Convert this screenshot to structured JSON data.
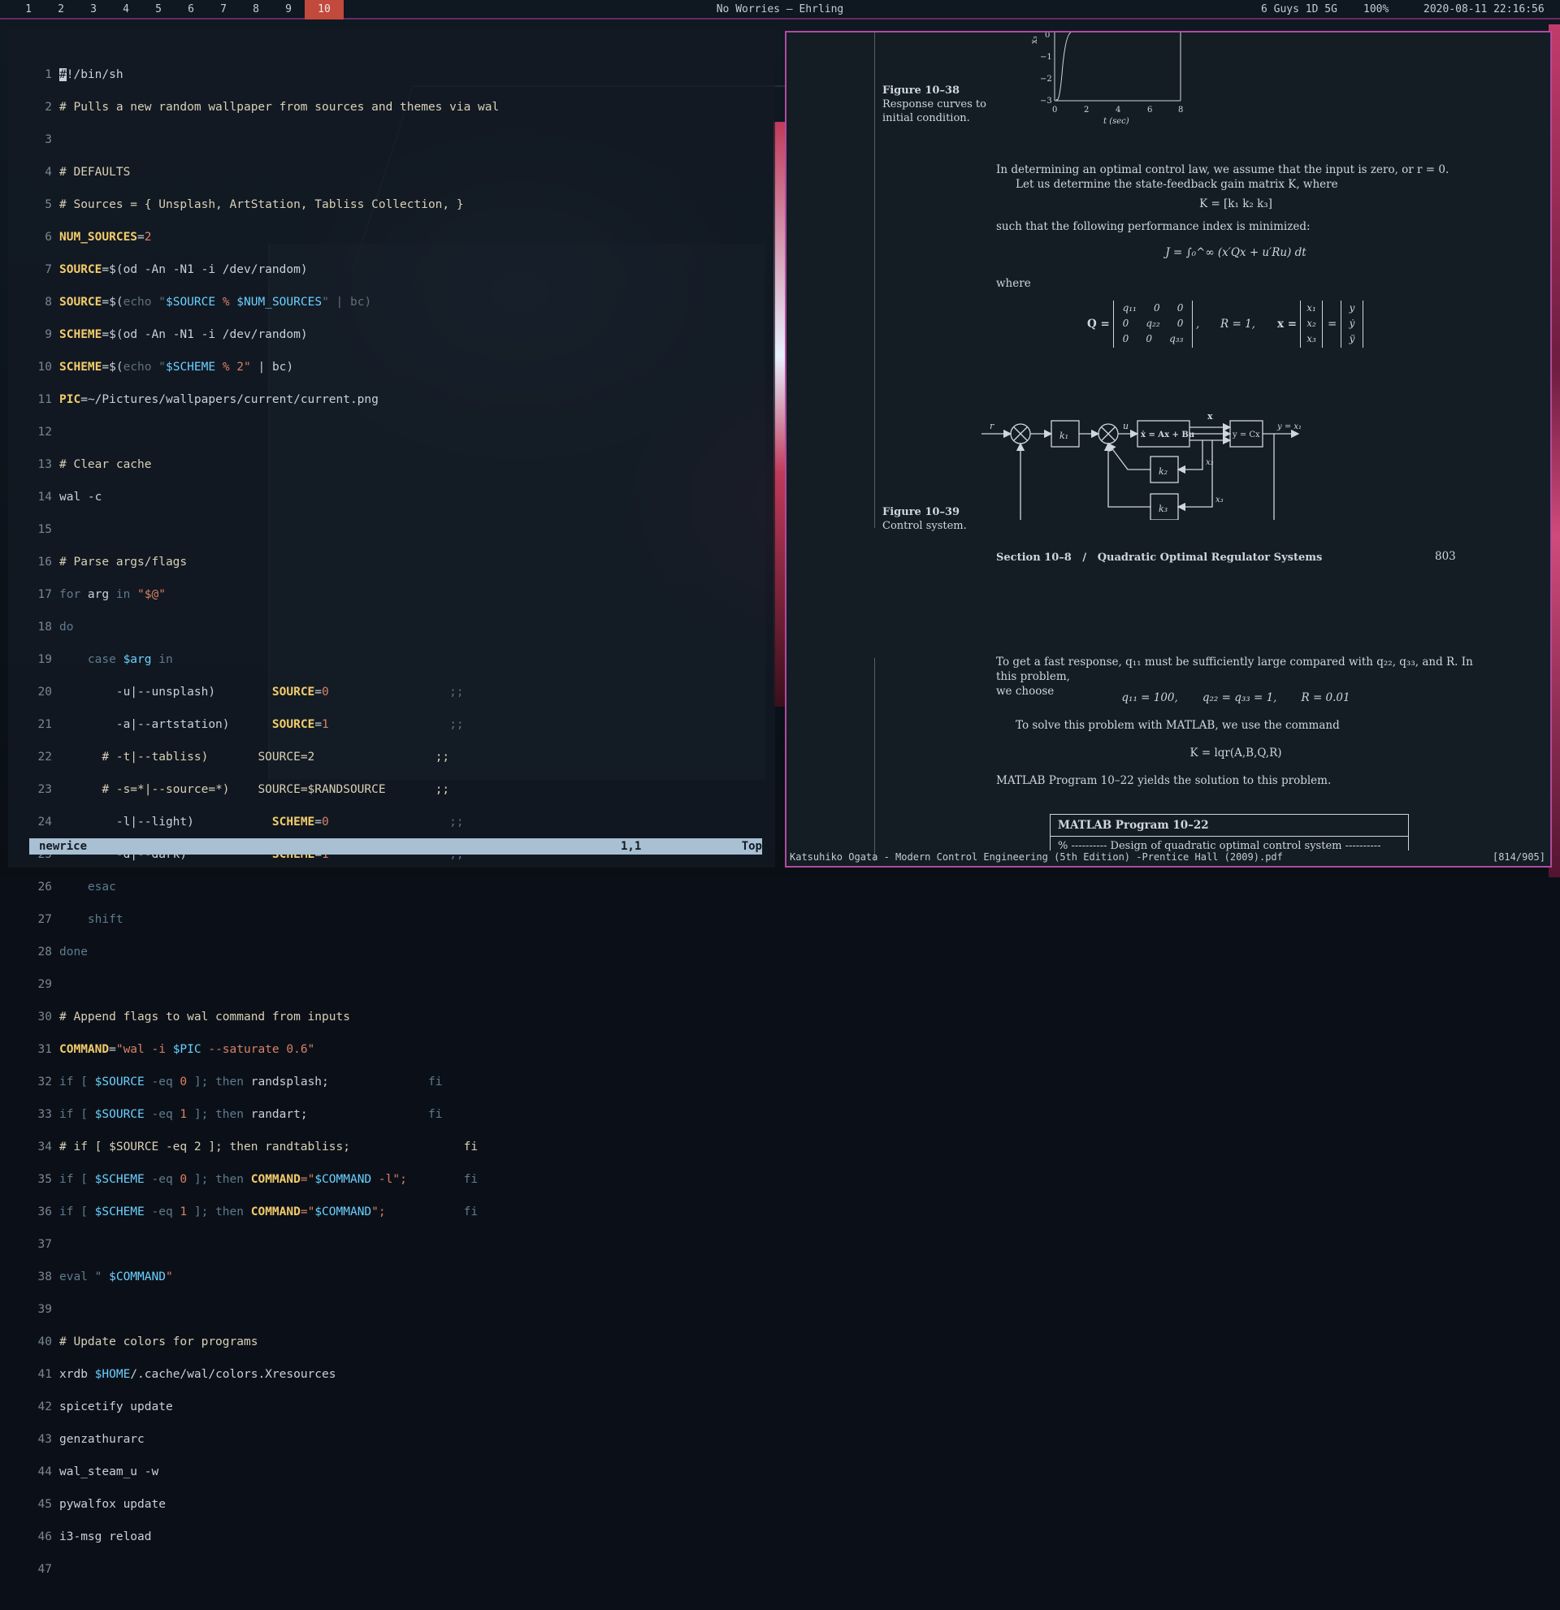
{
  "topbar": {
    "workspaces": [
      "1",
      "2",
      "3",
      "4",
      "5",
      "6",
      "7",
      "8",
      "9",
      "10"
    ],
    "active_workspace": "10",
    "title": "No Worries — Ehrling",
    "wifi": "6 Guys 1D 5G",
    "volume": "100%",
    "datetime": "2020-08-11 22:16:56"
  },
  "vim": {
    "line_numbers": [
      "1",
      "2",
      "3",
      "4",
      "5",
      "6",
      "7",
      "8",
      "9",
      "10",
      "11",
      "12",
      "13",
      "14",
      "15",
      "16",
      "17",
      "18",
      "19",
      "20",
      "21",
      "22",
      "23",
      "24",
      "25",
      "26",
      "27",
      "28",
      "29",
      "30",
      "31",
      "32",
      "33",
      "34",
      "35",
      "36",
      "37",
      "38",
      "39",
      "40",
      "41",
      "42",
      "43",
      "44",
      "45",
      "46",
      "47"
    ],
    "cursor_char": "#",
    "shebang_rest": "!/bin/sh",
    "lines": {
      "l2": "# Pulls a new random wallpaper from sources and themes via wal",
      "l4": "# DEFAULTS",
      "l5": "# Sources = { Unsplash, ArtStation, Tabliss Collection, }",
      "l6_var": "NUM_SOURCES",
      "l6_val": "2",
      "l7_var": "SOURCE",
      "l7_rest": "$(od -An -N1 -i /dev/random)",
      "l8_var": "SOURCE",
      "l8_a": "$(",
      "l8_b": "echo \"",
      "l8_c": "$SOURCE",
      "l8_d": " % ",
      "l8_e": "$NUM_SOURCES",
      "l8_f": "\" | bc)",
      "l9_var": "SCHEME",
      "l9_rest": "$(od -An -N1 -i /dev/random)",
      "l10_var": "SCHEME",
      "l10_a": "$(",
      "l10_b": "echo \"",
      "l10_c": "$SCHEME",
      "l10_d": " % 2\"",
      "l10_e": " | bc)",
      "l11_var": "PIC",
      "l11_rest": "~/Pictures/wallpapers/current/current.png",
      "l13": "# Clear cache",
      "l14": "wal -c",
      "l16": "# Parse args/flags",
      "l17_a": "for",
      "l17_b": " arg ",
      "l17_c": "in",
      "l17_d": " \"$@\"",
      "l18": "do",
      "l19_a": "case",
      "l19_b": " $arg ",
      "l19_c": "in",
      "l20_a": "-u|--unsplash)",
      "l20_var": "SOURCE",
      "l20_val": "0",
      "l20_end": ";;",
      "l21_a": "-a|--artstation)",
      "l21_var": "SOURCE",
      "l21_val": "1",
      "l21_end": ";;",
      "l22_a": "# -t|--tabliss)",
      "l22_b": "SOURCE=2",
      "l22_end": ";;",
      "l23_a": "# -s=*|--source=*)",
      "l23_b": "SOURCE=$RANDSOURCE",
      "l23_end": ";;",
      "l24_a": "-l|--light)",
      "l24_var": "SCHEME",
      "l24_val": "0",
      "l24_end": ";;",
      "l25_a": "-d|--dark)",
      "l25_var": "SCHEME",
      "l25_val": "1",
      "l25_end": ";;",
      "l26": "esac",
      "l27": "shift",
      "l28": "done",
      "l30": "# Append flags to wal command from inputs",
      "l31_var": "COMMAND",
      "l31_a": "\"wal -i ",
      "l31_b": "$PIC",
      "l31_c": " --saturate 0.6\"",
      "l32_a": "if [ ",
      "l32_b": "$SOURCE",
      "l32_c": " -eq ",
      "l32_d": "0",
      "l32_e": " ]; then ",
      "l32_f": "randsplash;",
      "l32_g": "fi",
      "l33_a": "if [ ",
      "l33_b": "$SOURCE",
      "l33_c": " -eq ",
      "l33_d": "1",
      "l33_e": " ]; then ",
      "l33_f": "randart;",
      "l33_g": "fi",
      "l34_a": "# if [ $SOURCE -eq 2 ]; then randtabliss;",
      "l34_g": "fi",
      "l35_a": "if [ ",
      "l35_b": "$SCHEME",
      "l35_c": " -eq ",
      "l35_d": "0",
      "l35_e": " ]; then ",
      "l35_var": "COMMAND",
      "l35_f": "=\"",
      "l35_h": "$COMMAND",
      "l35_i": " -l\";",
      "l35_g": "fi",
      "l36_a": "if [ ",
      "l36_b": "$SCHEME",
      "l36_c": " -eq ",
      "l36_d": "1",
      "l36_e": " ]; then ",
      "l36_var": "COMMAND",
      "l36_f": "=\"",
      "l36_h": "$COMMAND",
      "l36_i": "\";",
      "l36_g": "fi",
      "l38_a": "eval \" ",
      "l38_b": "$COMMAND",
      "l38_c": "\"",
      "l40": "# Update colors for programs",
      "l41_a": "xrdb ",
      "l41_b": "$HOME",
      "l41_c": "/.cache/wal/colors.Xresources",
      "l42": "spicetify update",
      "l43": "genzathurarc",
      "l44": "wal_steam_u -w",
      "l45": "pywalfox update",
      "l46": "i3-msg reload"
    },
    "status": {
      "filename": "newrice",
      "position": "1,1",
      "scroll": "Top"
    }
  },
  "pdf": {
    "figure_38": {
      "label": "Figure 10–38",
      "caption_1": "Response curves to",
      "caption_2": "initial condition."
    },
    "plot": {
      "y_label": "x₃",
      "y_ticks": [
        "0",
        "−1",
        "−2",
        "−3"
      ],
      "x_ticks": [
        "0",
        "2",
        "4",
        "6",
        "8"
      ],
      "x_label": "t (sec)"
    },
    "para_1": "In determining an optimal control law, we assume that the input is zero, or r = 0.",
    "para_2": "Let us determine the state-feedback gain matrix K, where",
    "eq_K": "K = [k₁   k₂   k₃]",
    "para_3": "such that the following performance index is minimized:",
    "eq_J": "J = ∫₀^∞ (x′Qx + u′Ru) dt",
    "where": "where",
    "eq_Q": "Q =",
    "q_matrix": [
      [
        "q₁₁",
        "0",
        "0"
      ],
      [
        "0",
        "q₂₂",
        "0"
      ],
      [
        "0",
        "0",
        "q₃₃"
      ]
    ],
    "eq_R": ",      R = 1,",
    "eq_x": "x =",
    "x_vec": [
      "x₁",
      "x₂",
      "x₃"
    ],
    "y_vec": [
      "y",
      "ẏ",
      "ÿ"
    ],
    "diagram": {
      "r": "r",
      "k1": "k₁",
      "u": "u",
      "plant": "ẋ = Ax + Bu",
      "x": "x",
      "out": "y = Cx",
      "y_out": "y = x₁",
      "k2": "k₂",
      "x2": "x₂",
      "k3": "k₃",
      "x3": "x₃"
    },
    "figure_39": {
      "label": "Figure 10–39",
      "caption": "Control system."
    },
    "section": "Section 10–8   /   Quadratic Optimal Regulator Systems",
    "page_number": "803",
    "para_4a": "To get a fast response, q₁₁ must be sufficiently large compared with q₂₂, q₃₃, and R. In this problem,",
    "para_4b": "we choose",
    "eq_q": "q₁₁ = 100,       q₂₂ = q₃₃ = 1,       R = 0.01",
    "para_5": "To solve this problem with MATLAB, we use the command",
    "eq_lqr": "K = lqr(A,B,Q,R)",
    "para_6": "MATLAB Program 10–22 yields the solution to this problem.",
    "program_title": "MATLAB Program 10–22",
    "program_line": "% ---------- Design of quadratic optimal control system ----------",
    "statusbar": {
      "filename": "Katsuhiko Ogata - Modern Control Engineering (5th Edition) -Prentice Hall (2009).pdf",
      "page": "[814/905]"
    }
  }
}
